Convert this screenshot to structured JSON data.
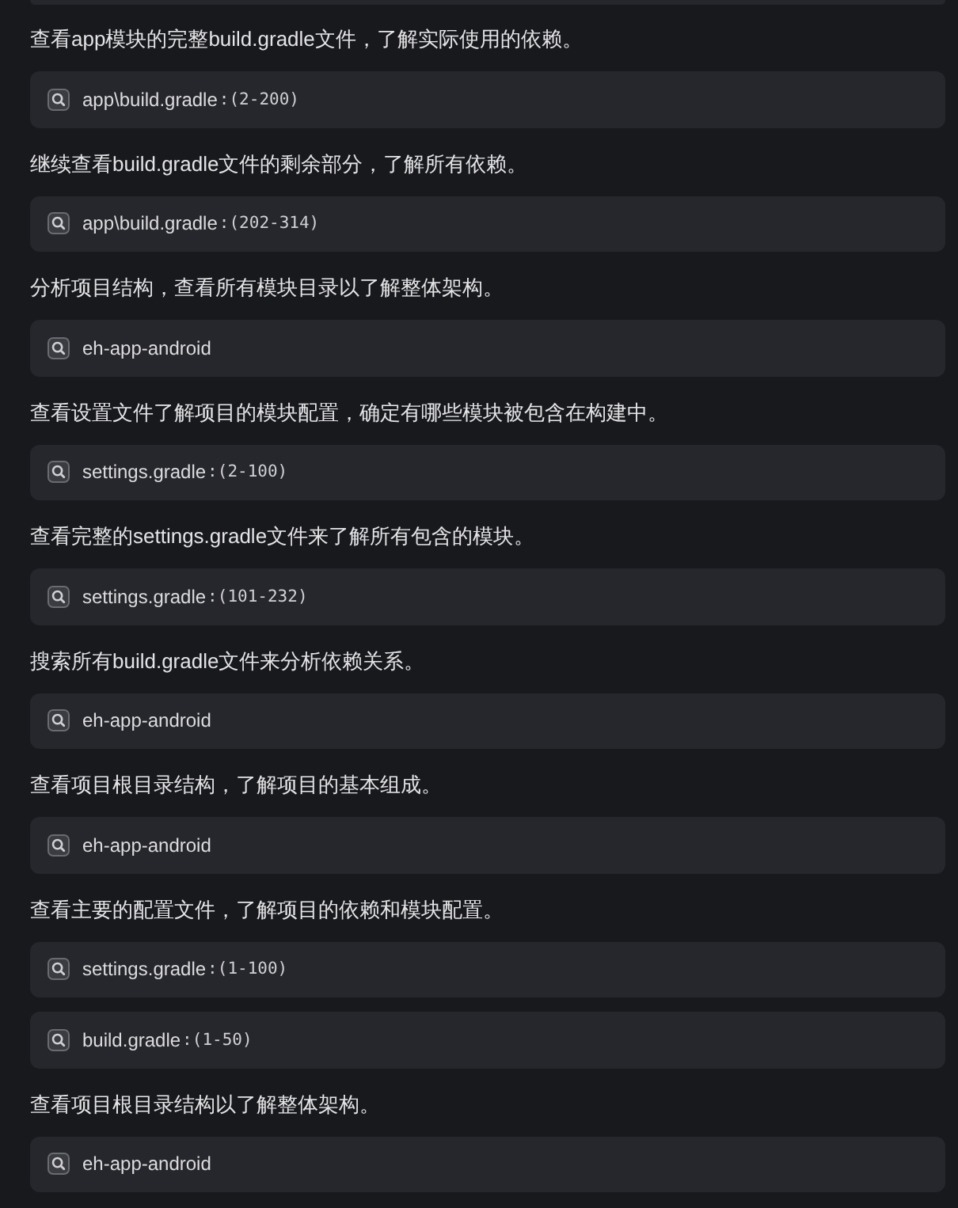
{
  "steps": [
    {
      "description": "查看app模块的完整build.gradle文件，了解实际使用的依赖。",
      "results": [
        {
          "path": "app\\build.gradle",
          "range": ":(2-200)"
        }
      ]
    },
    {
      "description": "继续查看build.gradle文件的剩余部分，了解所有依赖。",
      "results": [
        {
          "path": "app\\build.gradle",
          "range": ":(202-314)"
        }
      ]
    },
    {
      "description": "分析项目结构，查看所有模块目录以了解整体架构。",
      "results": [
        {
          "path": "eh-app-android"
        }
      ]
    },
    {
      "description": "查看设置文件了解项目的模块配置，确定有哪些模块被包含在构建中。",
      "results": [
        {
          "path": "settings.gradle",
          "range": ":(2-100)"
        }
      ]
    },
    {
      "description": "查看完整的settings.gradle文件来了解所有包含的模块。",
      "results": [
        {
          "path": "settings.gradle",
          "range": ":(101-232)"
        }
      ]
    },
    {
      "description": "搜索所有build.gradle文件来分析依赖关系。",
      "results": [
        {
          "path": "eh-app-android"
        }
      ]
    },
    {
      "description": "查看项目根目录结构，了解项目的基本组成。",
      "results": [
        {
          "path": "eh-app-android"
        }
      ]
    },
    {
      "description": "查看主要的配置文件，了解项目的依赖和模块配置。",
      "results": [
        {
          "path": "settings.gradle",
          "range": ":(1-100)"
        },
        {
          "path": "build.gradle",
          "range": ":(1-50)"
        }
      ]
    },
    {
      "description": "查看项目根目录结构以了解整体架构。",
      "results": [
        {
          "path": "eh-app-android"
        }
      ]
    }
  ]
}
